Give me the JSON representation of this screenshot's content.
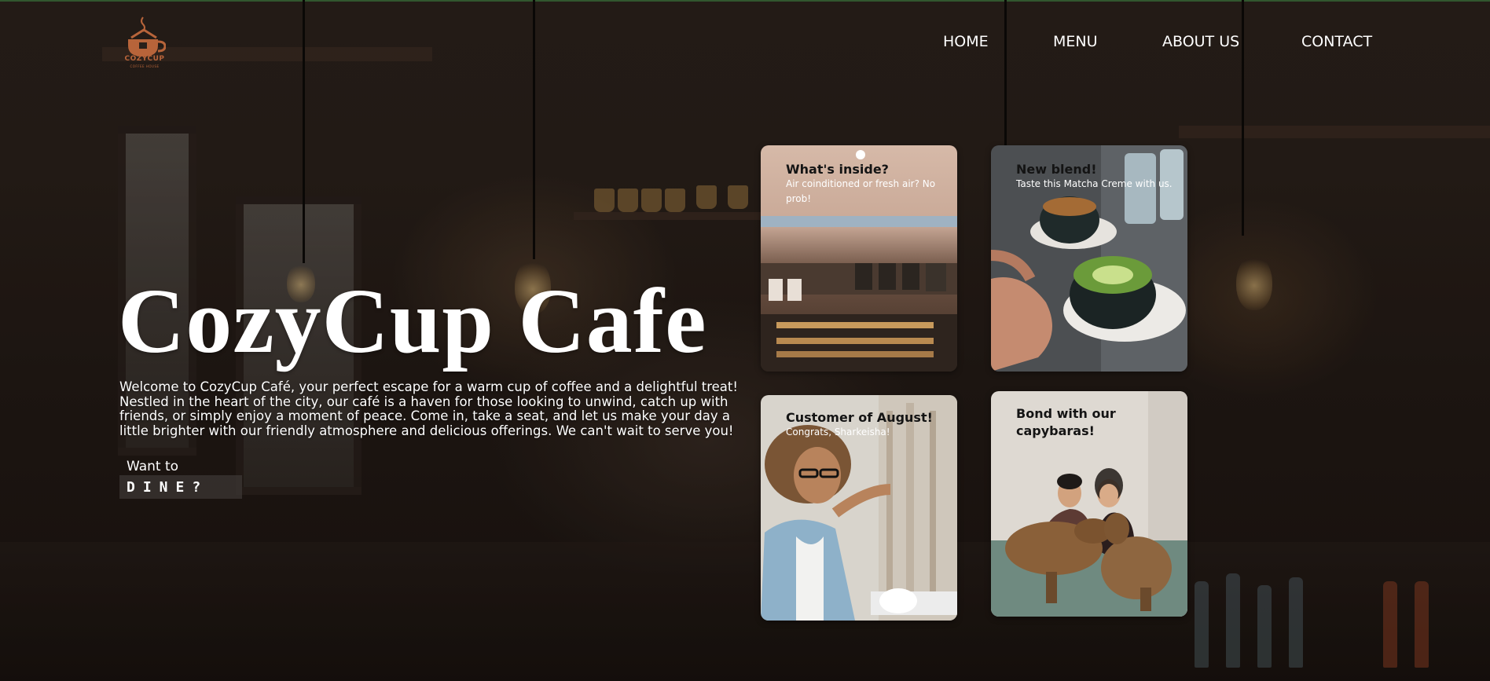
{
  "brand": {
    "logo_name": "CozyCup",
    "logo_tagline": "COFFEE HOUSE",
    "logo_color": "#b7643a"
  },
  "nav": {
    "items": [
      {
        "label": "HOME"
      },
      {
        "label": "MENU"
      },
      {
        "label": "ABOUT US"
      },
      {
        "label": "CONTACT"
      }
    ]
  },
  "hero": {
    "title": "CozyCup Cafe",
    "description": "Welcome to CozyCup Café, your perfect escape for a warm cup of coffee and a delightful treat! Nestled in the heart of the city, our café is a haven for those looking to unwind, catch up with friends, or simply enjoy a moment of peace. Come in, take a seat, and let us make your day a little brighter with our friendly atmosphere and delicious offerings. We can't wait to serve you!",
    "cta_prompt": "Want to",
    "cta_button": "DINE?"
  },
  "cards": [
    {
      "title": "What's inside?",
      "subtitle": "Air coinditioned or fresh air? No prob!",
      "image": "cafe-interior-photo"
    },
    {
      "title": "New blend!",
      "subtitle": "Taste this Matcha Creme with us.",
      "image": "matcha-latte-photo"
    },
    {
      "title": "Customer of August!",
      "subtitle": "Congrats, Sharkeisha!",
      "image": "customer-photo"
    },
    {
      "title": "Bond with our capybaras!",
      "subtitle": "",
      "image": "capybaras-photo"
    }
  ]
}
